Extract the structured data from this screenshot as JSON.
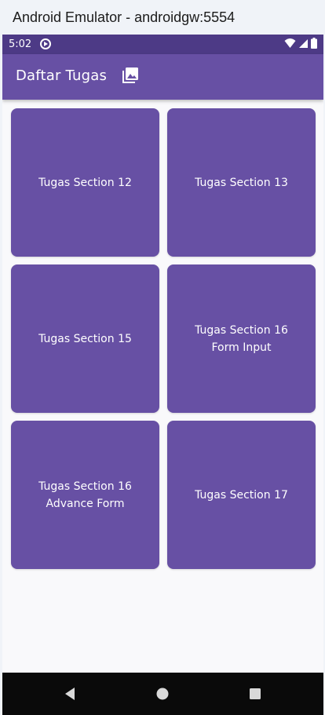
{
  "window": {
    "title": "Android Emulator - androidgw:5554"
  },
  "status_bar": {
    "time": "5:02",
    "icons": [
      "app-sync-icon",
      "wifi-icon",
      "signal-icon",
      "battery-icon"
    ]
  },
  "app_bar": {
    "title": "Daftar Tugas",
    "icon": "photo-library-icon",
    "background": "#6750a4"
  },
  "tasks": [
    {
      "label": "Tugas Section 12"
    },
    {
      "label": "Tugas Section 13"
    },
    {
      "label": "Tugas Section 15"
    },
    {
      "label": "Tugas Section 16\n Form Input"
    },
    {
      "label": "Tugas Section 16\nAdvance Form"
    },
    {
      "label": "Tugas Section 17"
    }
  ],
  "nav_bar": {
    "buttons": [
      "back-icon",
      "home-icon",
      "recents-icon"
    ]
  },
  "colors": {
    "accent": "#6750a4",
    "status_bar": "#4d3a86",
    "page_background": "#f9f9fb",
    "nav_bar": "#0a0a0a"
  }
}
